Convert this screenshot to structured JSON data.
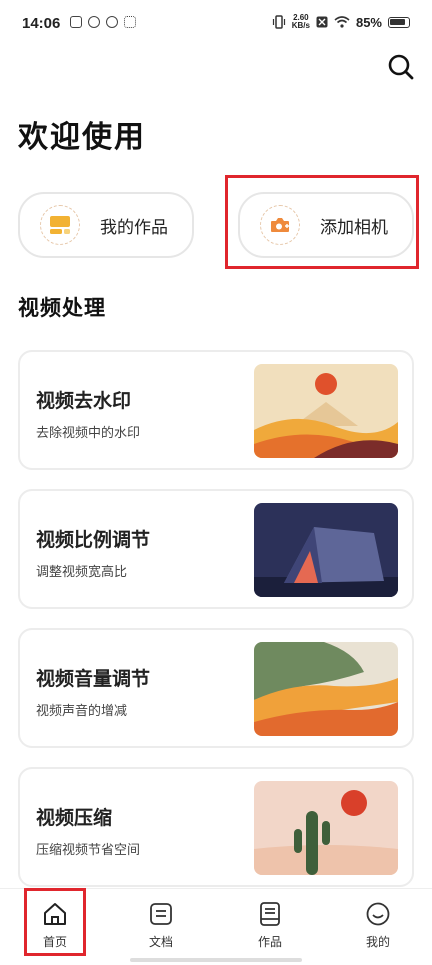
{
  "status": {
    "time": "14:06",
    "net_speed_value": "2.60",
    "net_speed_unit": "KB/s",
    "battery": "85%"
  },
  "header": {
    "welcome": "欢迎使用",
    "search_icon": "search-icon"
  },
  "quick_actions": [
    {
      "label": "我的作品",
      "icon": "works-icon",
      "color": "#f2b233"
    },
    {
      "label": "添加相机",
      "icon": "camera-icon",
      "color": "#ef8a3c"
    }
  ],
  "section": {
    "title": "视频处理"
  },
  "features": [
    {
      "title": "视频去水印",
      "subtitle": "去除视频中的水印",
      "image": "desert-sun-illustration"
    },
    {
      "title": "视频比例调节",
      "subtitle": "调整视频宽高比",
      "image": "tent-night-illustration"
    },
    {
      "title": "视频音量调节",
      "subtitle": "视频声音的增减",
      "image": "hills-waves-illustration"
    },
    {
      "title": "视频压缩",
      "subtitle": "压缩视频节省空间",
      "image": "cactus-sun-illustration"
    }
  ],
  "nav": [
    {
      "label": "首页",
      "icon": "home-icon"
    },
    {
      "label": "文档",
      "icon": "document-icon"
    },
    {
      "label": "作品",
      "icon": "works-book-icon"
    },
    {
      "label": "我的",
      "icon": "profile-smile-icon"
    }
  ],
  "colors": {
    "highlight": "#e0262d",
    "accent_orange": "#ef8a3c"
  }
}
